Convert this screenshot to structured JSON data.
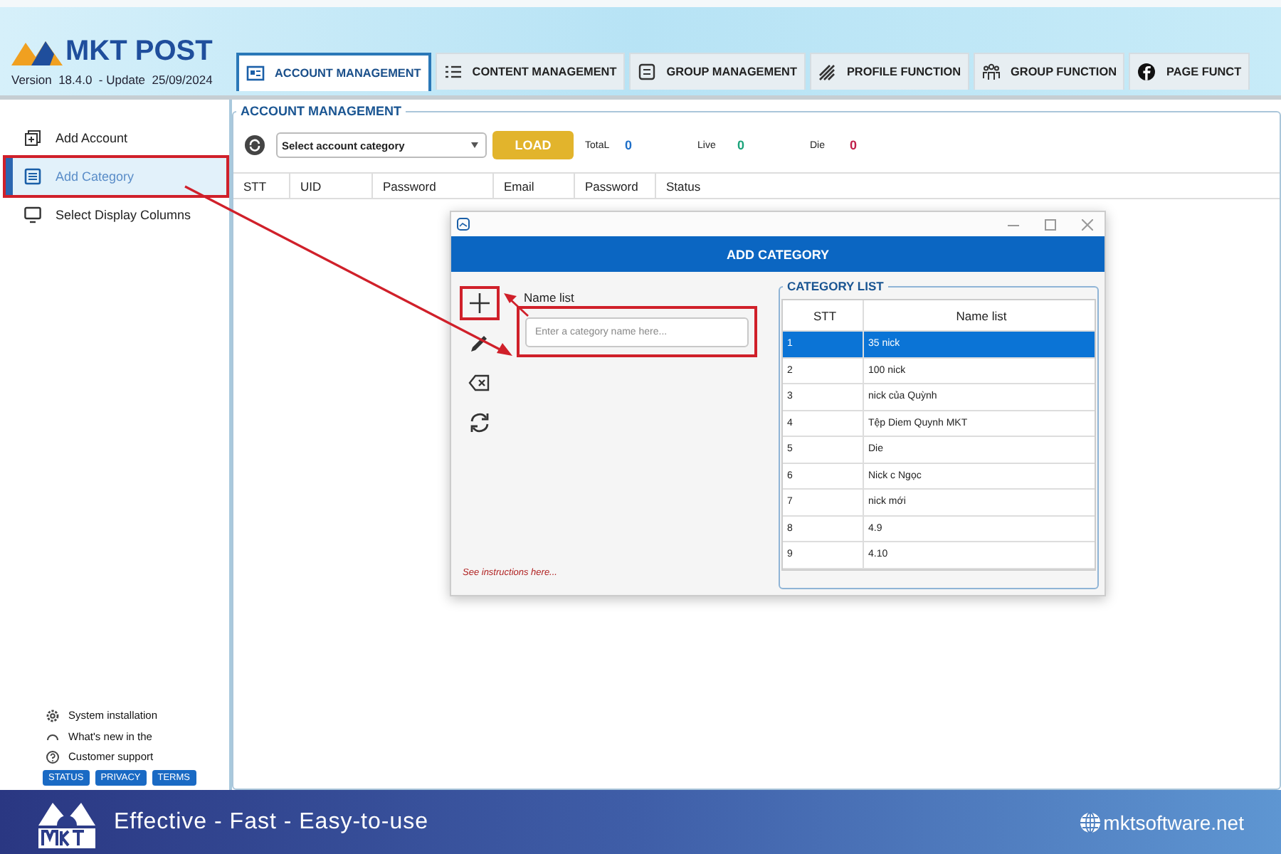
{
  "app": {
    "title": "MKT POST",
    "version": "Version  18.4.0  - Update  25/09/2024"
  },
  "tabs": [
    {
      "kind": "account",
      "label": "ACCOUNT MANAGEMENT",
      "selected": true
    },
    {
      "kind": "content",
      "label": "CONTENT MANAGEMENT",
      "selected": false
    },
    {
      "kind": "group",
      "label": "GROUP MANAGEMENT",
      "selected": false
    },
    {
      "kind": "profile",
      "label": "PROFILE FUNCTION",
      "selected": false
    },
    {
      "kind": "people",
      "label": "GROUP FUNCTION",
      "selected": false
    },
    {
      "kind": "page",
      "label": "PAGE FUNCT",
      "selected": false
    }
  ],
  "sidebar": {
    "items": [
      {
        "kind": "add",
        "label": "Add Account",
        "selected": false,
        "highlighted": false
      },
      {
        "kind": "category",
        "label": "Add Category",
        "selected": true,
        "highlighted": true
      },
      {
        "kind": "monitor",
        "label": "Select Display Columns",
        "selected": false,
        "highlighted": false
      }
    ],
    "footer_items": [
      {
        "kind": "gear",
        "label": "System installation"
      },
      {
        "kind": "arc",
        "label": "What's new in the"
      },
      {
        "kind": "help",
        "label": "Customer support"
      }
    ],
    "footer_links": [
      "STATUS",
      "PRIVACY",
      "TERMS"
    ]
  },
  "account_management": {
    "title": "ACCOUNT MANAGEMENT",
    "category_select": {
      "value": "Select account category"
    },
    "load_button": "LOAD",
    "stats": [
      {
        "label": "TotaL",
        "value": "0",
        "color": "#1e6fc8"
      },
      {
        "label": "Live",
        "value": "0",
        "color": "#1aa37a"
      },
      {
        "label": "Die",
        "value": "0",
        "color": "#c0204a"
      }
    ],
    "table": {
      "columns": [
        "STT",
        "UID",
        "Password",
        "Email",
        "Password",
        "Status"
      ]
    }
  },
  "dialog": {
    "title": "ADD CATEGORY",
    "tools": [
      {
        "kind": "add",
        "highlighted": true
      },
      {
        "kind": "edit",
        "highlighted": false
      },
      {
        "kind": "delete",
        "highlighted": false
      },
      {
        "kind": "refresh",
        "highlighted": false
      }
    ],
    "field_label": "Name list",
    "name_field": {
      "placeholder": "Enter a category name here...",
      "highlighted": true
    },
    "help_link": "See instructions here...",
    "category_list": {
      "title": "CATEGORY LIST",
      "columns": [
        "STT",
        "Name list"
      ],
      "rows": [
        {
          "cells": [
            "1",
            "35 nick"
          ],
          "selected": true
        },
        {
          "cells": [
            "2",
            "100 nick"
          ],
          "selected": false
        },
        {
          "cells": [
            "3",
            "nick của Quỳnh"
          ],
          "selected": false
        },
        {
          "cells": [
            "4",
            "Tệp Diem Quynh MKT"
          ],
          "selected": false
        },
        {
          "cells": [
            "5",
            "Die"
          ],
          "selected": false
        },
        {
          "cells": [
            "6",
            "Nick c Ngọc"
          ],
          "selected": false
        },
        {
          "cells": [
            "7",
            "nick mới"
          ],
          "selected": false
        },
        {
          "cells": [
            "8",
            "4.9"
          ],
          "selected": false
        },
        {
          "cells": [
            "9",
            "4.10"
          ],
          "selected": false
        }
      ]
    }
  },
  "banner": {
    "slogan": "Effective - Fast - Easy-to-use",
    "website": "mktsoftware.net"
  }
}
